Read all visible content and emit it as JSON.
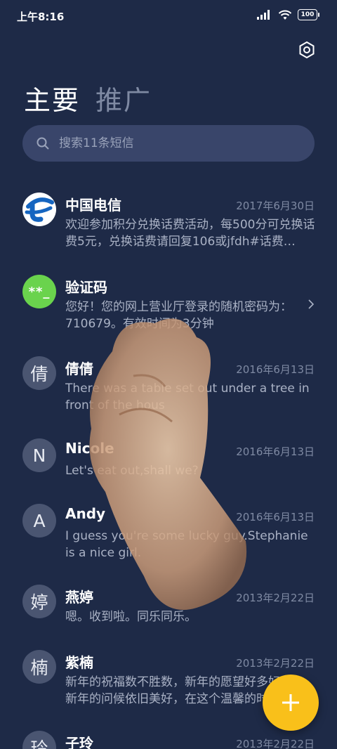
{
  "status_bar": {
    "time": "上午8:16",
    "battery": "100"
  },
  "tabs": [
    {
      "label": "主要",
      "active": true
    },
    {
      "label": "推广",
      "active": false
    }
  ],
  "search": {
    "placeholder": "搜索11条短信"
  },
  "messages": [
    {
      "name": "中国电信",
      "avatar": "telecom-logo",
      "date": "2017年6月30日",
      "preview": "欢迎参加积分兑换话费活动，每500分可兑换话费5元，兑换话费请回复106或jfdh#话费…"
    },
    {
      "name": "验证码",
      "avatar": "**_",
      "date": "",
      "preview": "您好！您的网上营业厅登录的随机密码为：710679。有效时间为3分钟"
    },
    {
      "name": "倩倩",
      "avatar": "倩",
      "date": "2016年6月13日",
      "preview": "There was a table set out under a tree in front of the hous"
    },
    {
      "name": "Nicole",
      "avatar": "N",
      "date": "2016年6月13日",
      "preview": "Let's eat out,shall we?"
    },
    {
      "name": "Andy",
      "avatar": "A",
      "date": "2016年6月13日",
      "preview": "I guess you're some lucky guy.Stephanie is a nice girl."
    },
    {
      "name": "燕婷",
      "avatar": "婷",
      "date": "2013年2月22日",
      "preview": "嗯。收到啦。同乐同乐。"
    },
    {
      "name": "紫楠",
      "avatar": "楠",
      "date": "2013年2月22日",
      "preview": "新年的祝福数不胜数，新年的愿望好多好多，新年的问候依旧美好，在这个温馨的时刻"
    },
    {
      "name": "子玲",
      "avatar": "玲",
      "date": "2013年2月22日",
      "preview": ""
    }
  ],
  "colors": {
    "background": "#1e2a47",
    "fab": "#f9c01a",
    "verify_avatar": "#6ad34d"
  }
}
